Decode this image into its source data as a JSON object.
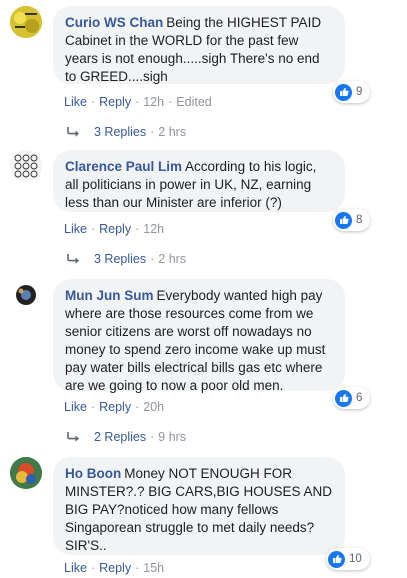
{
  "comments": [
    {
      "author": "Curio WS Chan",
      "text": "Being the HIGHEST PAID Cabinet in the WORLD for the past few years is not enough.....sigh There's no end to GREED....sigh",
      "like": "Like",
      "reply": "Reply",
      "time": "12h",
      "edited": "Edited",
      "reaction_count": "9",
      "replies_label": "3 Replies",
      "replies_time": "2 hrs"
    },
    {
      "author": "Clarence Paul Lim",
      "text": "According to his logic, all politicians in power in UK, NZ, earning less than our Minister are inferior (?)",
      "like": "Like",
      "reply": "Reply",
      "time": "12h",
      "reaction_count": "8",
      "replies_label": "3 Replies",
      "replies_time": "2 hrs"
    },
    {
      "author": "Mun Jun Sum",
      "text": "Everybody wanted high pay where are those resources come from we senior citizens are worst off nowadays no money to spend zero income wake up must pay water bills electrical bills gas etc where are we going to now a poor old men.",
      "like": "Like",
      "reply": "Reply",
      "time": "20h",
      "reaction_count": "6",
      "replies_label": "2 Replies",
      "replies_time": "9 hrs"
    },
    {
      "author": "Ho Boon",
      "text": "Money NOT ENOUGH FOR MINSTER?.? BIG CARS,BIG HOUSES AND BIG PAY?noticed how many fellows Singaporean struggle to met daily needs? SIR'S..",
      "like": "Like",
      "reply": "Reply",
      "time": "15h",
      "reaction_count": "10"
    }
  ],
  "colors": {
    "link": "#385898",
    "meta": "#90949c",
    "bubble": "#f2f3f5",
    "like_blue": "#1877f2"
  }
}
